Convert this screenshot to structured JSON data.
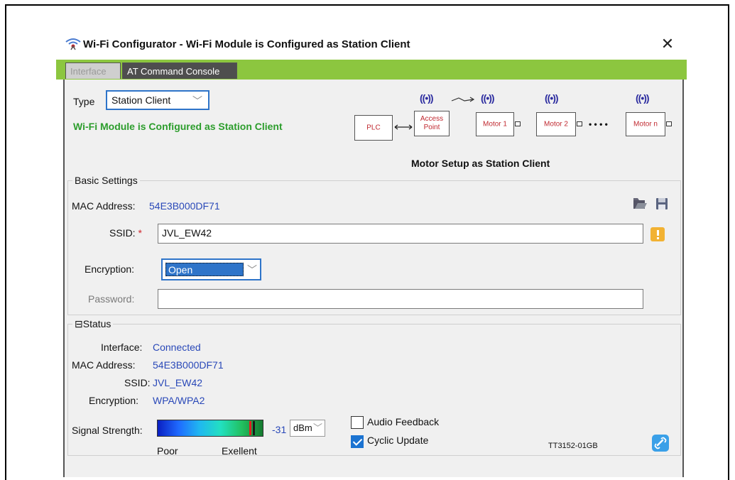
{
  "window": {
    "title": "Wi-Fi Configurator - Wi-Fi Module is Configured as Station Client",
    "close_symbol": "✕"
  },
  "tabs": [
    {
      "label": "Interface"
    },
    {
      "label": "AT Command Console"
    }
  ],
  "type": {
    "label": "Type",
    "value": "Station Client",
    "status": "Wi-Fi Module is Configured as Station Client"
  },
  "diagram": {
    "plc": "PLC",
    "access_point_line1": "Access",
    "access_point_line2": "Point",
    "motor1": "Motor 1",
    "motor2": "Motor 2",
    "motorn": "Motor n",
    "dots": "• • • •",
    "antenna": "((•))",
    "caption": "Motor Setup as Station Client"
  },
  "basic": {
    "title": "Basic Settings",
    "mac_label": "MAC Address:",
    "mac_value": "54E3B000DF71",
    "ssid_label": "SSID:",
    "ssid_required": "*",
    "ssid_value": "JVL_EW42",
    "encryption_label": "Encryption:",
    "encryption_value": "Open",
    "password_label": "Password:",
    "password_value": ""
  },
  "status": {
    "title": "Status",
    "collapse_symbol": "⊟",
    "interface_label": "Interface:",
    "interface_value": "Connected",
    "mac_label": "MAC Address:",
    "mac_value": "54E3B000DF71",
    "ssid_label": "SSID:",
    "ssid_value": "JVL_EW42",
    "encryption_label": "Encryption:",
    "encryption_value": "WPA/WPA2",
    "signal_label": "Signal Strength:",
    "signal_value": "-31",
    "signal_unit": "dBm",
    "poor_label": "Poor",
    "excellent_label": "Exellent",
    "audio_feedback_label": "Audio Feedback",
    "audio_feedback_checked": false,
    "cyclic_update_label": "Cyclic Update",
    "cyclic_update_checked": true
  },
  "doc_ref": "TT3152-01GB",
  "colors": {
    "accent_green": "#8cc63f",
    "status_green": "#2c9d2c",
    "value_blue": "#2948b8",
    "select_blue": "#2e74c9"
  }
}
